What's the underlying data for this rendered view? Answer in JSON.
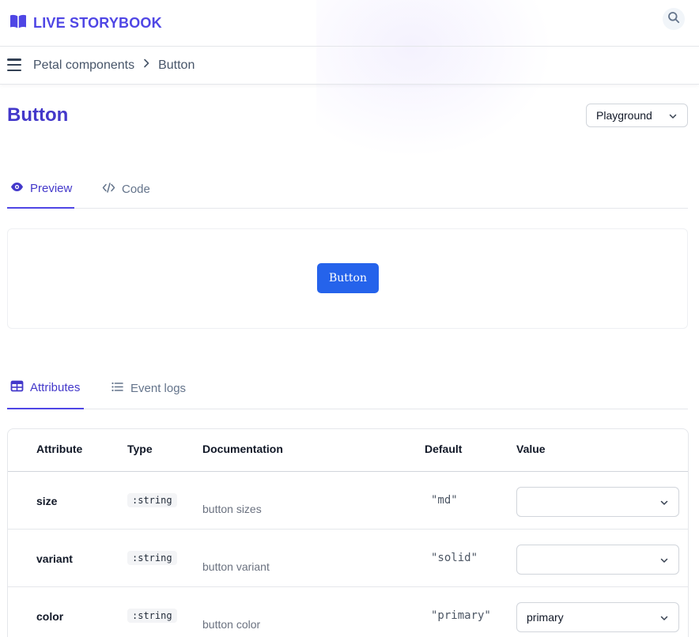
{
  "app": {
    "name": "LIVE STORYBOOK",
    "brand_color": "#4f46e5",
    "logo_icon": "book-open-icon",
    "search_icon": "search-icon"
  },
  "breadcrumb": {
    "items": [
      "Petal components",
      "Button"
    ]
  },
  "page": {
    "title": "Button",
    "variation_select": {
      "value": "Playground"
    }
  },
  "story_tabs": [
    {
      "label": "Preview",
      "icon": "eye-icon",
      "active": true
    },
    {
      "label": "Code",
      "icon": "code-icon",
      "active": false
    }
  ],
  "preview": {
    "button_label": "Button",
    "button_color": "#2563eb"
  },
  "playground_tabs": [
    {
      "label": "Attributes",
      "icon": "table-icon",
      "active": true
    },
    {
      "label": "Event logs",
      "icon": "list-icon",
      "active": false
    }
  ],
  "attributes_table": {
    "headers": [
      "Attribute",
      "Type",
      "Documentation",
      "Default",
      "Value"
    ],
    "rows": [
      {
        "name": "size",
        "type": ":string",
        "doc": "button sizes",
        "default": "\"md\"",
        "value": ""
      },
      {
        "name": "variant",
        "type": ":string",
        "doc": "button variant",
        "default": "\"solid\"",
        "value": ""
      },
      {
        "name": "color",
        "type": ":string",
        "doc": "button color",
        "default": "\"primary\"",
        "value": "primary"
      }
    ]
  }
}
